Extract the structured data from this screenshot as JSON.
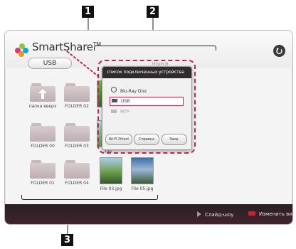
{
  "callouts": [
    "1",
    "2",
    "3"
  ],
  "app": {
    "title": "SmartShare",
    "tm": "TM",
    "device_button": "USB",
    "ghost_tab_fragment": "ныка"
  },
  "colors": {
    "accent": "#c8234c",
    "bottom_bar": "#3a2129",
    "popup_title_bg": "#312b2e",
    "logo_dots": [
      "#e3347b",
      "#8cc63f",
      "#00aeef",
      "#f7931e"
    ]
  },
  "tiles": [
    {
      "type": "up-folder",
      "label": "папка вверх"
    },
    {
      "type": "folder",
      "label": "FOLDER 02"
    },
    {
      "type": "photo",
      "label": "File"
    },
    {
      "type": "folder",
      "label": "FOLDER 00"
    },
    {
      "type": "folder",
      "label": "FOLDER 03"
    },
    {
      "type": "photo",
      "label": "File"
    },
    {
      "type": "folder",
      "label": "FOLDER 01"
    },
    {
      "type": "folder",
      "label": "FOLDER 04"
    },
    {
      "type": "photo",
      "label": "File 03.jpg"
    },
    {
      "type": "photo",
      "label": "File 05.jpg"
    }
  ],
  "popup": {
    "title": "список подключенных устройства",
    "devices": [
      {
        "icon": "disc-icon",
        "label": "Blu-Ray Disc",
        "state": "normal"
      },
      {
        "icon": "usb-icon",
        "label": "USB",
        "state": "selected"
      },
      {
        "icon": "dlna-server-icon",
        "label": "MTP",
        "state": "dimmed"
      }
    ],
    "buttons": [
      "Wi-Fi Direct",
      "Справка",
      "Закр."
    ]
  },
  "bottom_bar": {
    "slideshow_label": "Слайд-шоу",
    "view_label": "Изменить вид"
  }
}
